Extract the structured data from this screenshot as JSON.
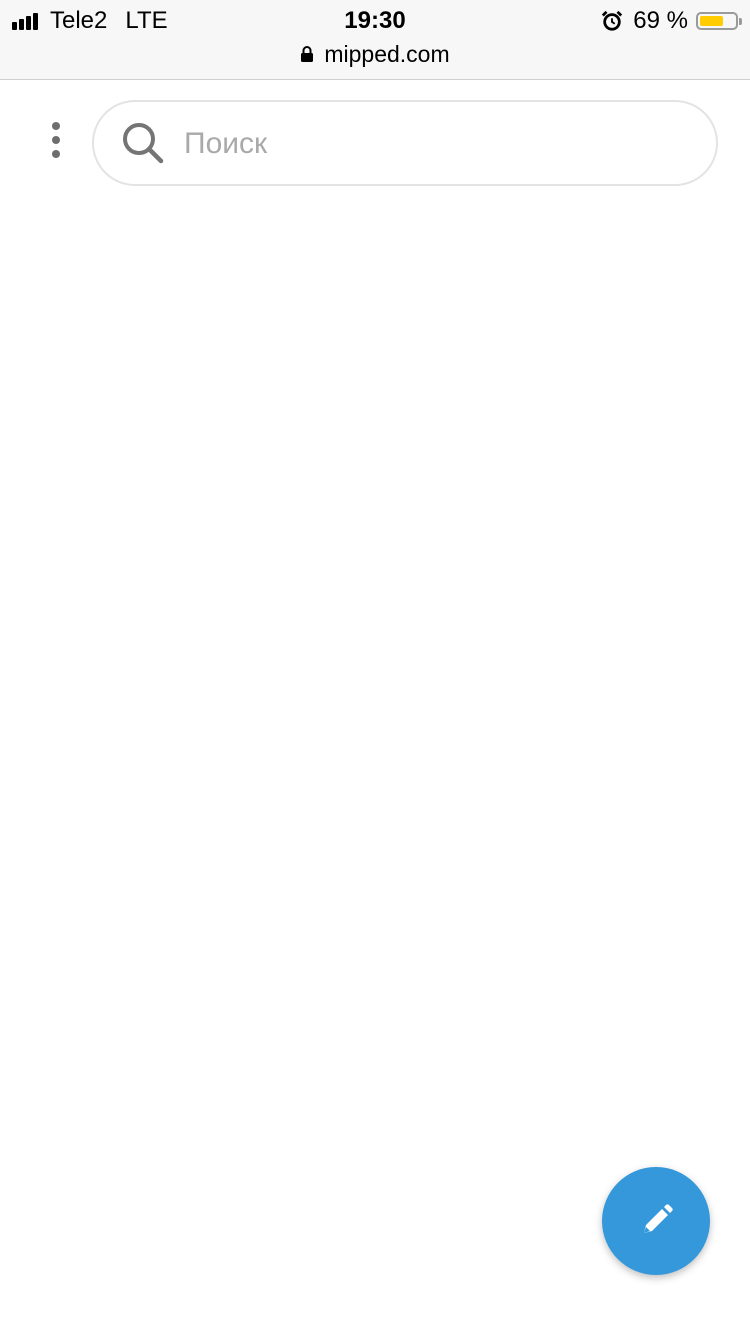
{
  "status_bar": {
    "carrier": "Tele2",
    "network": "LTE",
    "time": "19:30",
    "battery_text": "69 %",
    "battery_level": 0.69,
    "battery_color": "#ffcc00"
  },
  "browser": {
    "url": "mipped.com"
  },
  "header": {
    "menu_icon": "more-vertical-icon",
    "search": {
      "placeholder": "Поиск",
      "value": "",
      "icon": "search-icon"
    }
  },
  "fab": {
    "icon": "pencil-icon",
    "color": "#3498db"
  }
}
